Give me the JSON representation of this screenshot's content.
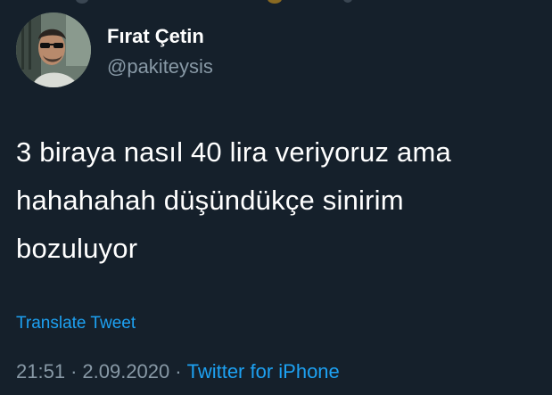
{
  "user": {
    "display_name": "Fırat Çetin",
    "handle": "@pakiteysis",
    "avatar": "profile-photo"
  },
  "tweet": {
    "lines": [
      "3 biraya nasıl 40 lira veriyoruz ama",
      "hahahahah düşündükçe sinirim",
      "bozuluyor"
    ],
    "translate_label": "Translate Tweet"
  },
  "meta": {
    "time": "21:51",
    "separator": "·",
    "date": "2.09.2020",
    "source": "Twitter for iPhone"
  },
  "colors": {
    "background": "#15202b",
    "text": "#ffffff",
    "secondary": "#8899a6",
    "accent": "#1da1f2"
  }
}
